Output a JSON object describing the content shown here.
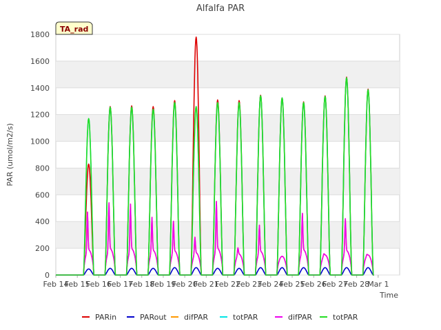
{
  "chart_data": {
    "type": "line",
    "title": "Alfalfa PAR",
    "xlabel": "Time",
    "ylabel": "PAR (umol/m2/s)",
    "ylim": [
      0,
      1800
    ],
    "xlim": [
      "2024-02-14",
      "2024-03-01"
    ],
    "yticks": [
      0,
      200,
      400,
      600,
      800,
      1000,
      1200,
      1400,
      1600,
      1800
    ],
    "xticks": [
      "Feb 14",
      "Feb 15",
      "Feb 16",
      "Feb 17",
      "Feb 18",
      "Feb 19",
      "Feb 20",
      "Feb 21",
      "Feb 22",
      "Feb 23",
      "Feb 24",
      "Feb 25",
      "Feb 26",
      "Feb 27",
      "Feb 28",
      "Mar 1"
    ],
    "badge": "TA_rad",
    "grid": "horizontal bands",
    "legend_position": "bottom",
    "days": [
      "2024-02-15",
      "2024-02-16",
      "2024-02-17",
      "2024-02-18",
      "2024-02-19",
      "2024-02-20",
      "2024-02-21",
      "2024-02-22",
      "2024-02-23",
      "2024-02-24",
      "2024-02-25",
      "2024-02-26",
      "2024-02-27",
      "2024-02-28"
    ],
    "series": [
      {
        "name": "PARin",
        "color": "#dd0000",
        "daily_peak": [
          830,
          1260,
          1265,
          1260,
          1305,
          1780,
          1310,
          1305,
          1345,
          1325,
          1295,
          1340,
          1480,
          1390
        ]
      },
      {
        "name": "PARout",
        "color": "#0000cc",
        "daily_peak": [
          45,
          50,
          50,
          50,
          55,
          55,
          50,
          50,
          55,
          55,
          55,
          55,
          55,
          55
        ]
      },
      {
        "name": "difPAR",
        "color": "#ff9900",
        "daily_peak": [
          480,
          550,
          540,
          440,
          410,
          290,
          560,
          210,
          380,
          140,
          470,
          165,
          430,
          160
        ]
      },
      {
        "name": "totPAR",
        "color": "#00e5e5",
        "daily_peak": [
          1170,
          1255,
          1255,
          1240,
          1290,
          1260,
          1290,
          1290,
          1340,
          1325,
          1290,
          1335,
          1475,
          1385
        ]
      },
      {
        "name": "difPAR",
        "color": "#ee00ee",
        "daily_peak": [
          480,
          550,
          540,
          440,
          410,
          290,
          560,
          210,
          380,
          140,
          470,
          165,
          430,
          160
        ]
      },
      {
        "name": "totPAR",
        "color": "#22dd22",
        "daily_peak": [
          1170,
          1255,
          1255,
          1240,
          1290,
          1260,
          1290,
          1290,
          1340,
          1325,
          1290,
          1335,
          1475,
          1385
        ]
      }
    ]
  }
}
